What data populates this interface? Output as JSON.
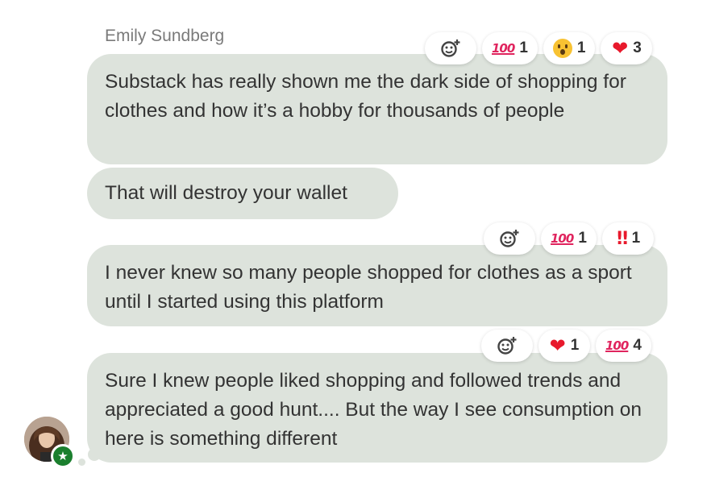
{
  "sender": {
    "name": "Emily Sundberg"
  },
  "messages": [
    {
      "text": "Substack has really shown me the dark side of shopping for clothes and how it’s a hobby for thousands of people",
      "reactions": [
        {
          "icon": "add-reaction-icon",
          "count": ""
        },
        {
          "icon": "hundred-points-icon",
          "glyph": "100",
          "count": "1"
        },
        {
          "icon": "surprised-face-icon",
          "count": "1"
        },
        {
          "icon": "red-heart-icon",
          "glyph": "❤",
          "count": "3"
        }
      ]
    },
    {
      "text": "That will destroy your wallet",
      "reactions": []
    },
    {
      "text": "I never knew so many people shopped for clothes as a sport until I started using this platform",
      "reactions": [
        {
          "icon": "add-reaction-icon",
          "count": ""
        },
        {
          "icon": "hundred-points-icon",
          "glyph": "100",
          "count": "1"
        },
        {
          "icon": "double-exclamation-icon",
          "glyph": "!!",
          "count": "1"
        }
      ]
    },
    {
      "text": "Sure I knew people liked shopping and followed trends and appreciated a good hunt.... But the way I see consumption on here is something different",
      "reactions": [
        {
          "icon": "add-reaction-icon",
          "count": ""
        },
        {
          "icon": "red-heart-icon",
          "glyph": "❤",
          "count": "1"
        },
        {
          "icon": "hundred-points-icon",
          "glyph": "100",
          "count": "4"
        }
      ]
    }
  ],
  "badge": {
    "icon": "star-icon",
    "glyph": "★"
  },
  "colors": {
    "bubble": "#dde3dc",
    "badge": "#1b7f2e",
    "hundred": "#e0245e",
    "heart": "#e8192c"
  }
}
